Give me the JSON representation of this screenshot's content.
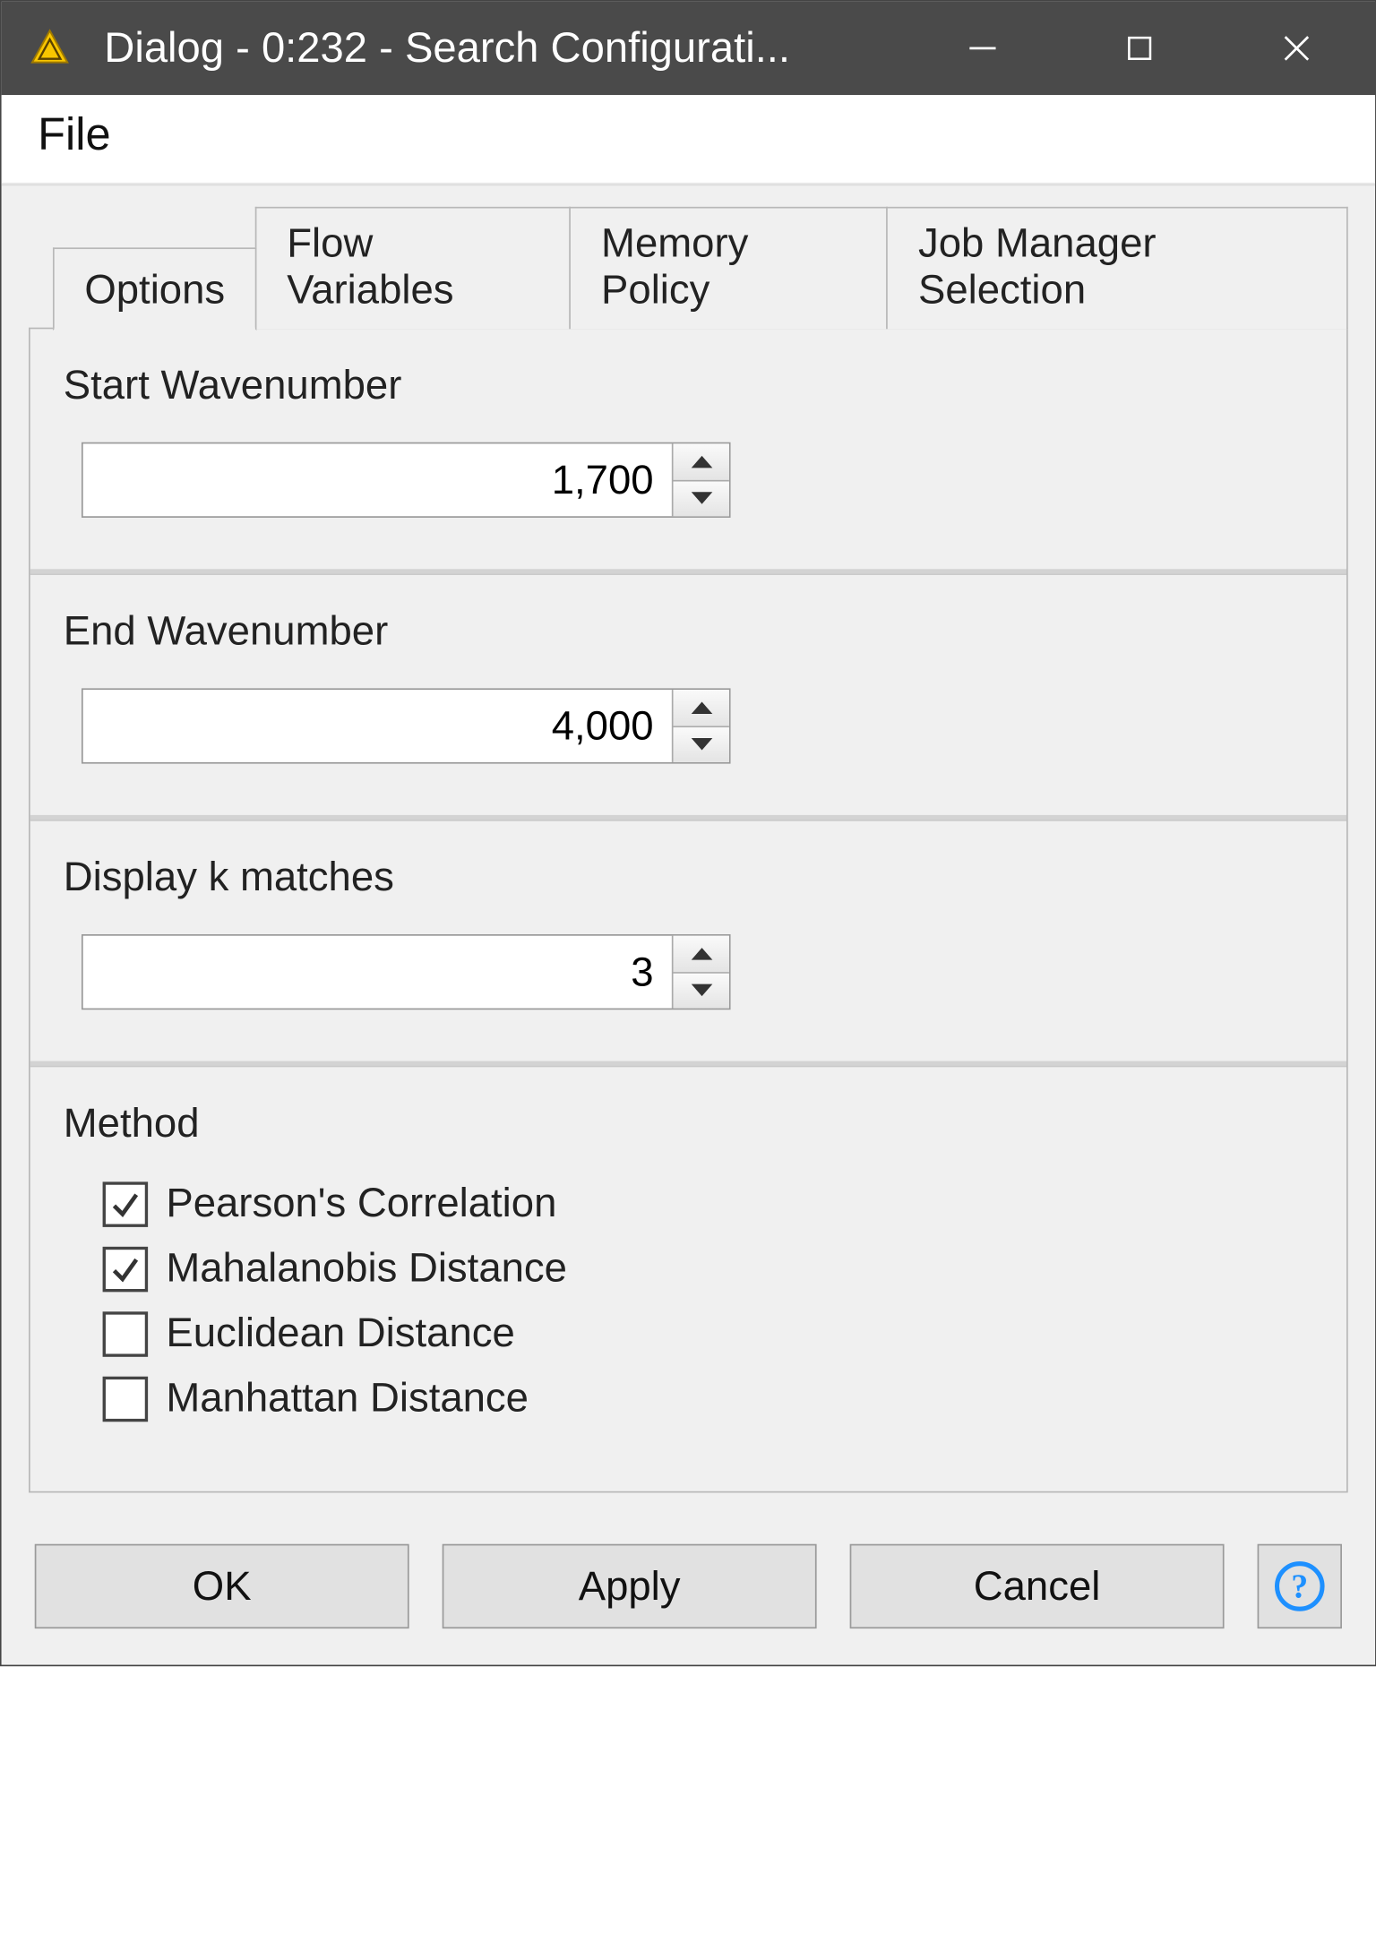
{
  "window": {
    "title": "Dialog - 0:232 - Search Configurati..."
  },
  "menubar": {
    "file": "File"
  },
  "tabs": [
    {
      "label": "Options",
      "active": true
    },
    {
      "label": "Flow Variables",
      "active": false
    },
    {
      "label": "Memory Policy",
      "active": false
    },
    {
      "label": "Job Manager Selection",
      "active": false
    }
  ],
  "options": {
    "start_wavenumber": {
      "label": "Start Wavenumber",
      "value": "1,700"
    },
    "end_wavenumber": {
      "label": "End Wavenumber",
      "value": "4,000"
    },
    "display_k": {
      "label": "Display k matches",
      "value": "3"
    },
    "method": {
      "label": "Method",
      "items": [
        {
          "label": "Pearson's Correlation",
          "checked": true
        },
        {
          "label": "Mahalanobis Distance",
          "checked": true
        },
        {
          "label": "Euclidean Distance",
          "checked": false
        },
        {
          "label": "Manhattan Distance",
          "checked": false
        }
      ]
    }
  },
  "buttons": {
    "ok": "OK",
    "apply": "Apply",
    "cancel": "Cancel"
  }
}
